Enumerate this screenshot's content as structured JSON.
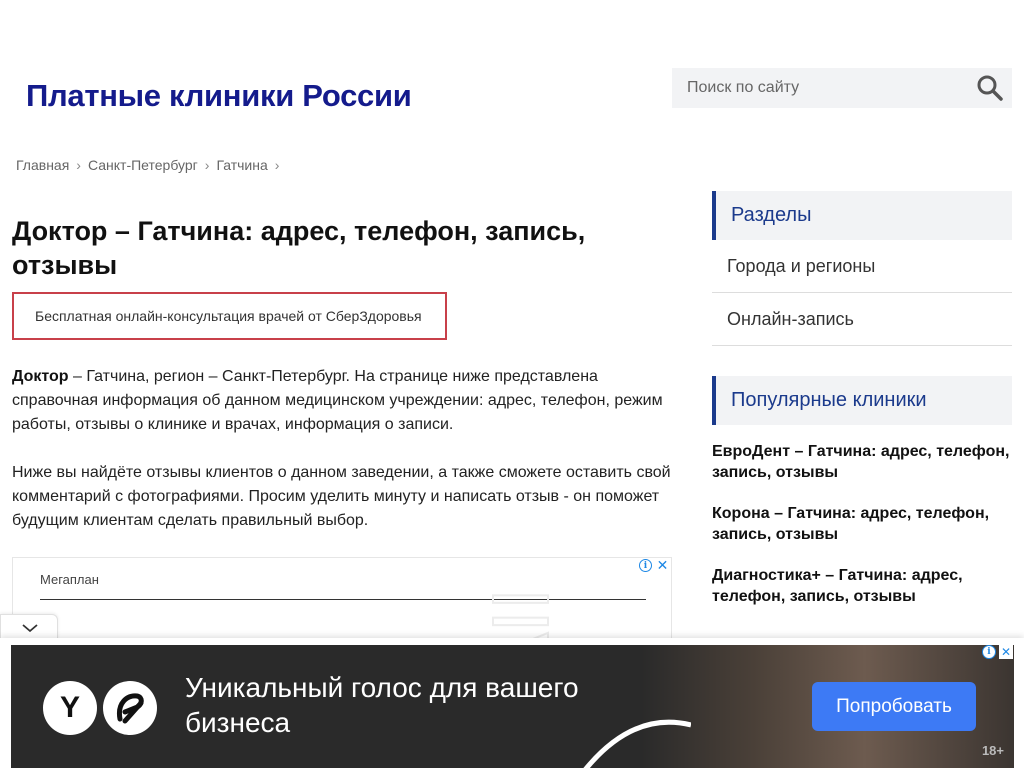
{
  "header": {
    "site_title": "Платные клиники России",
    "search": {
      "placeholder": "Поиск по сайту"
    }
  },
  "breadcrumb": [
    "Главная",
    "Санкт-Петербург",
    "Гатчина"
  ],
  "page": {
    "title": "Доктор – Гатчина: адрес, телефон, запись, отзывы",
    "promo_link": "Бесплатная онлайн-консультация врачей от СберЗдоровья",
    "intro_name": "Доктор",
    "intro_rest": " – Гатчина, регион – Санкт-Петербург. На странице ниже представлена справочная информация об данном медицинском учреждении: адрес, телефон, режим работы, отзывы о клинике и врачах, информация о записи.",
    "intro_p2": "Ниже вы найдёте отзывы клиентов о данном заведении, а также сможете оставить свой комментарий с фотографиями. Просим уделить минуту и написать отзыв - он поможет будущим клиентам сделать правильный выбор."
  },
  "inline_ad": {
    "label": "Мегаплан",
    "info_icon": "info-icon",
    "close_icon": "close-icon"
  },
  "sidebar": {
    "sections_title": "Разделы",
    "sections": [
      "Города и регионы",
      "Онлайн-запись"
    ],
    "popular_title": "Популярные клиники",
    "popular": [
      "ЕвроДент – Гатчина: адрес, телефон, запись, отзывы",
      "Корона – Гатчина: адрес, телефон, запись, отзывы",
      "Диагностика+ – Гатчина: адрес, телефон, запись, отзывы"
    ]
  },
  "bottom_banner": {
    "headline": "Уникальный голос для вашего бизнеса",
    "cta": "Попробовать",
    "age": "18+",
    "logo1": "Y",
    "colors": {
      "background": "#2a2a2a",
      "cta": "#3d7af5"
    }
  },
  "colors": {
    "title": "#141b8c",
    "accent": "#1b3a8c",
    "promo_border": "#c8404a"
  }
}
